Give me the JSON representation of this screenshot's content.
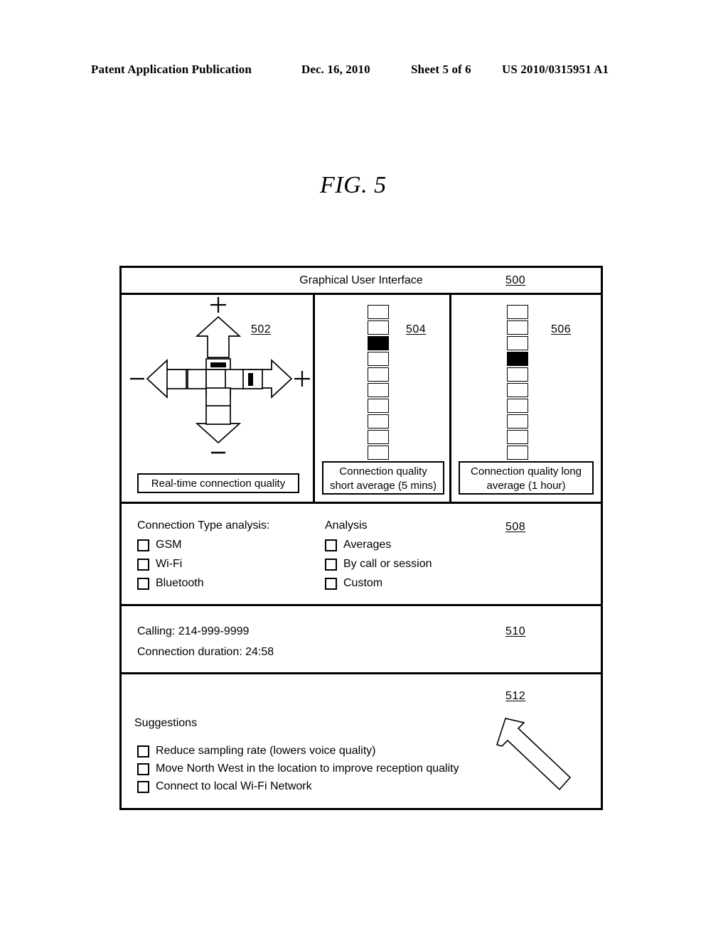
{
  "page_header": {
    "publication": "Patent Application Publication",
    "date": "Dec. 16, 2010",
    "sheet": "Sheet 5 of 6",
    "patent_number": "US 2010/0315951 A1"
  },
  "figure": {
    "title": "FIG. 5"
  },
  "gui": {
    "title": "Graphical User Interface",
    "ref": "500",
    "panels": {
      "realtime": {
        "ref": "502",
        "caption": "Real-time connection quality",
        "plus_top": "+",
        "minus_bottom": "–",
        "minus_left": "–",
        "plus_right": "+",
        "vertical_cells": 6,
        "vertical_filled_index": 0,
        "horizontal_cells": 5,
        "horizontal_filled_index": 4
      },
      "short_average": {
        "ref": "504",
        "caption_line1": "Connection quality",
        "caption_line2": "short average (5 mins)",
        "cells": 10,
        "filled_index": 2
      },
      "long_average": {
        "ref": "506",
        "caption_line1": "Connection quality long",
        "caption_line2": "average (1 hour)",
        "cells": 10,
        "filled_index": 3
      }
    },
    "analysis_section": {
      "ref": "508",
      "connection_type_heading": "Connection Type analysis:",
      "connection_type_options": [
        "GSM",
        "Wi-Fi",
        "Bluetooth"
      ],
      "analysis_heading": "Analysis",
      "analysis_options": [
        "Averages",
        "By call or session",
        "Custom"
      ]
    },
    "call_section": {
      "ref": "510",
      "calling_line": "Calling:  214-999-9999",
      "duration_line": "Connection duration:  24:58"
    },
    "suggestions_section": {
      "ref": "512",
      "heading": "Suggestions",
      "items": [
        "Reduce sampling rate (lowers voice quality)",
        "Move North West in the location to improve reception quality",
        "Connect to local Wi-Fi Network"
      ],
      "arrow_direction": "north-west"
    }
  }
}
